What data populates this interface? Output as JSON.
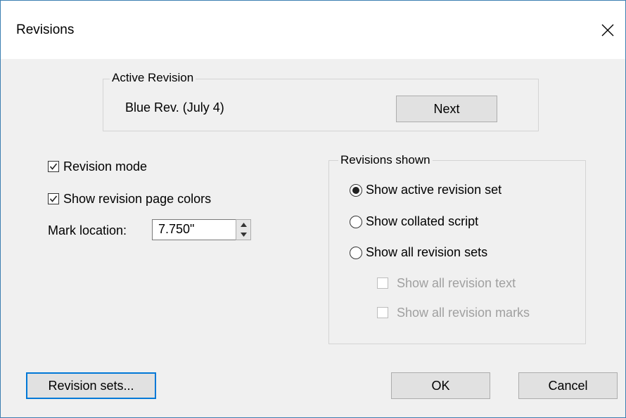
{
  "window": {
    "title": "Revisions"
  },
  "active_revision": {
    "group_label": "Active Revision",
    "current": "Blue Rev. (July 4)",
    "next_button": "Next"
  },
  "options": {
    "revision_mode": {
      "label": "Revision mode",
      "checked": true
    },
    "page_colors": {
      "label": "Show revision page colors",
      "checked": true
    },
    "mark_location": {
      "label": "Mark location:",
      "value": "7.750\""
    }
  },
  "revisions_shown": {
    "group_label": "Revisions shown",
    "active_set": {
      "label": "Show active revision set",
      "selected": true
    },
    "collated": {
      "label": "Show collated script",
      "selected": false
    },
    "all_sets": {
      "label": "Show all revision sets",
      "selected": false
    },
    "all_text": {
      "label": "Show all revision text",
      "checked": false,
      "enabled": false
    },
    "all_marks": {
      "label": "Show all revision marks",
      "checked": false,
      "enabled": false
    }
  },
  "buttons": {
    "revision_sets": "Revision sets...",
    "ok": "OK",
    "cancel": "Cancel"
  },
  "icons": {
    "close": "close-icon",
    "check": "checkmark-icon",
    "spin_up": "spin-up-icon",
    "spin_down": "spin-down-icon"
  }
}
